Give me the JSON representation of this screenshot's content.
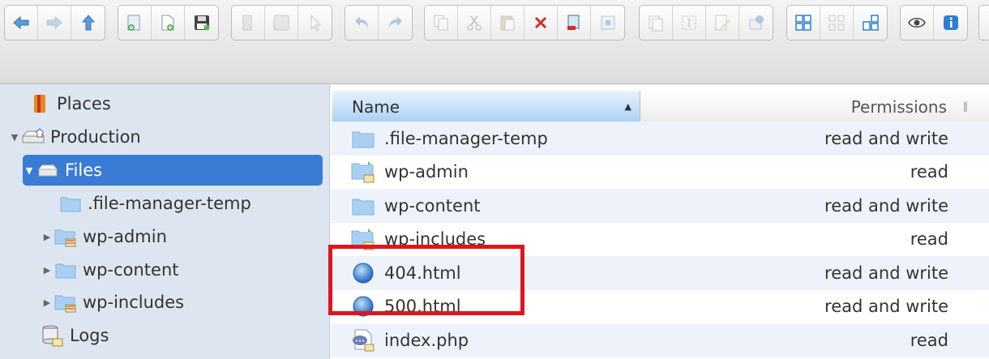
{
  "toolbar": {
    "groups": [
      [
        "back-icon",
        "forward-icon",
        "up-icon"
      ],
      [
        "new-folder-icon",
        "new-file-icon",
        "save-icon"
      ],
      [
        "open-icon",
        "save-disabled-icon",
        "select-icon"
      ],
      [
        "undo-icon",
        "redo-icon"
      ],
      [
        "copy-icon",
        "cut-icon",
        "paste-icon",
        "delete-icon",
        "rename-icon",
        "resize-icon"
      ],
      [
        "duplicate-icon",
        "select-all-icon",
        "edit-icon",
        "share-icon"
      ],
      [
        "icons-view-icon",
        "small-icons-view-icon",
        "list-view-icon"
      ],
      [
        "preview-icon",
        "info-icon"
      ]
    ]
  },
  "tree": {
    "items": [
      {
        "label": "Places",
        "icon": "places-icon",
        "level": 0,
        "expander": ""
      },
      {
        "label": "Production",
        "icon": "server-icon",
        "level": 0,
        "expander": "▼"
      },
      {
        "label": "Files",
        "icon": "drive-icon",
        "level": 1,
        "expander": "▼",
        "selected": true
      },
      {
        "label": ".file-manager-temp",
        "icon": "folder-icon",
        "level": 2,
        "expander": ""
      },
      {
        "label": "wp-admin",
        "icon": "folder-locked-icon",
        "level": 2,
        "expander": "▶"
      },
      {
        "label": "wp-content",
        "icon": "folder-icon",
        "level": 2,
        "expander": "▶"
      },
      {
        "label": "wp-includes",
        "icon": "folder-locked-icon",
        "level": 2,
        "expander": "▶"
      },
      {
        "label": "Logs",
        "icon": "logs-icon",
        "level": 1,
        "expander": ""
      }
    ]
  },
  "list": {
    "columns": {
      "name": "Name",
      "permissions": "Permissions"
    },
    "rows": [
      {
        "name": ".file-manager-temp",
        "perm": "read and write",
        "icon": "folder-icon"
      },
      {
        "name": "wp-admin",
        "perm": "read",
        "icon": "folder-locked-icon"
      },
      {
        "name": "wp-content",
        "perm": "read and write",
        "icon": "folder-icon"
      },
      {
        "name": "wp-includes",
        "perm": "read",
        "icon": "folder-locked-icon"
      },
      {
        "name": "404.html",
        "perm": "read and write",
        "icon": "html-file-icon"
      },
      {
        "name": "500.html",
        "perm": "read and write",
        "icon": "html-file-icon"
      },
      {
        "name": "index.php",
        "perm": "read",
        "icon": "php-file-icon"
      }
    ]
  },
  "highlight_color": "#e0141e"
}
